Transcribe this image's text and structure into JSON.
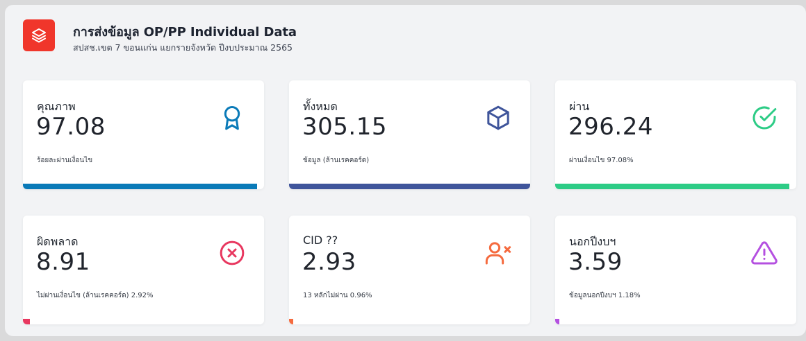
{
  "header": {
    "title": "การส่งข้อมูล OP/PP Individual Data",
    "subtitle": "สปสช.เขต 7 ขอนแก่น แยกรายจังหวัด ปีงบประมาณ 2565",
    "logo_icon": "layers-icon",
    "logo_color": "#f0362b"
  },
  "cards": [
    {
      "label": "คุณภาพ",
      "value": "97.08",
      "note": "ร้อยละผ่านเงื่อนไข",
      "icon": "award-icon",
      "color": "#0a7ab8",
      "bar_fill": 0.97
    },
    {
      "label": "ทั้งหมด",
      "value": "305.15",
      "note": "ข้อมูล (ล้านเรคคอร์ด)",
      "icon": "box-icon",
      "color": "#3f559b",
      "bar_fill": 1.0
    },
    {
      "label": "ผ่าน",
      "value": "296.24",
      "note": "ผ่านเงื่อนไข 97.08%",
      "icon": "check-circle-icon",
      "color": "#2dcc86",
      "bar_fill": 0.97
    },
    {
      "label": "ผิดพลาด",
      "value": "8.91",
      "note": "ไม่ผ่านเงื่อนไข (ล้านเรคคอร์ด) 2.92%",
      "icon": "x-circle-icon",
      "color": "#e8375f",
      "bar_fill": 0.03
    },
    {
      "label": "CID ??",
      "value": "2.93",
      "note": "13 หลักไม่ผ่าน 0.96%",
      "icon": "user-x-icon",
      "color": "#f56b3f",
      "bar_fill": 0.01
    },
    {
      "label": "นอกปีงบฯ",
      "value": "3.59",
      "note": "ข้อมูลนอกปีงบฯ 1.18%",
      "icon": "alert-triangle-icon",
      "color": "#b450e0",
      "bar_fill": 0.01
    }
  ]
}
